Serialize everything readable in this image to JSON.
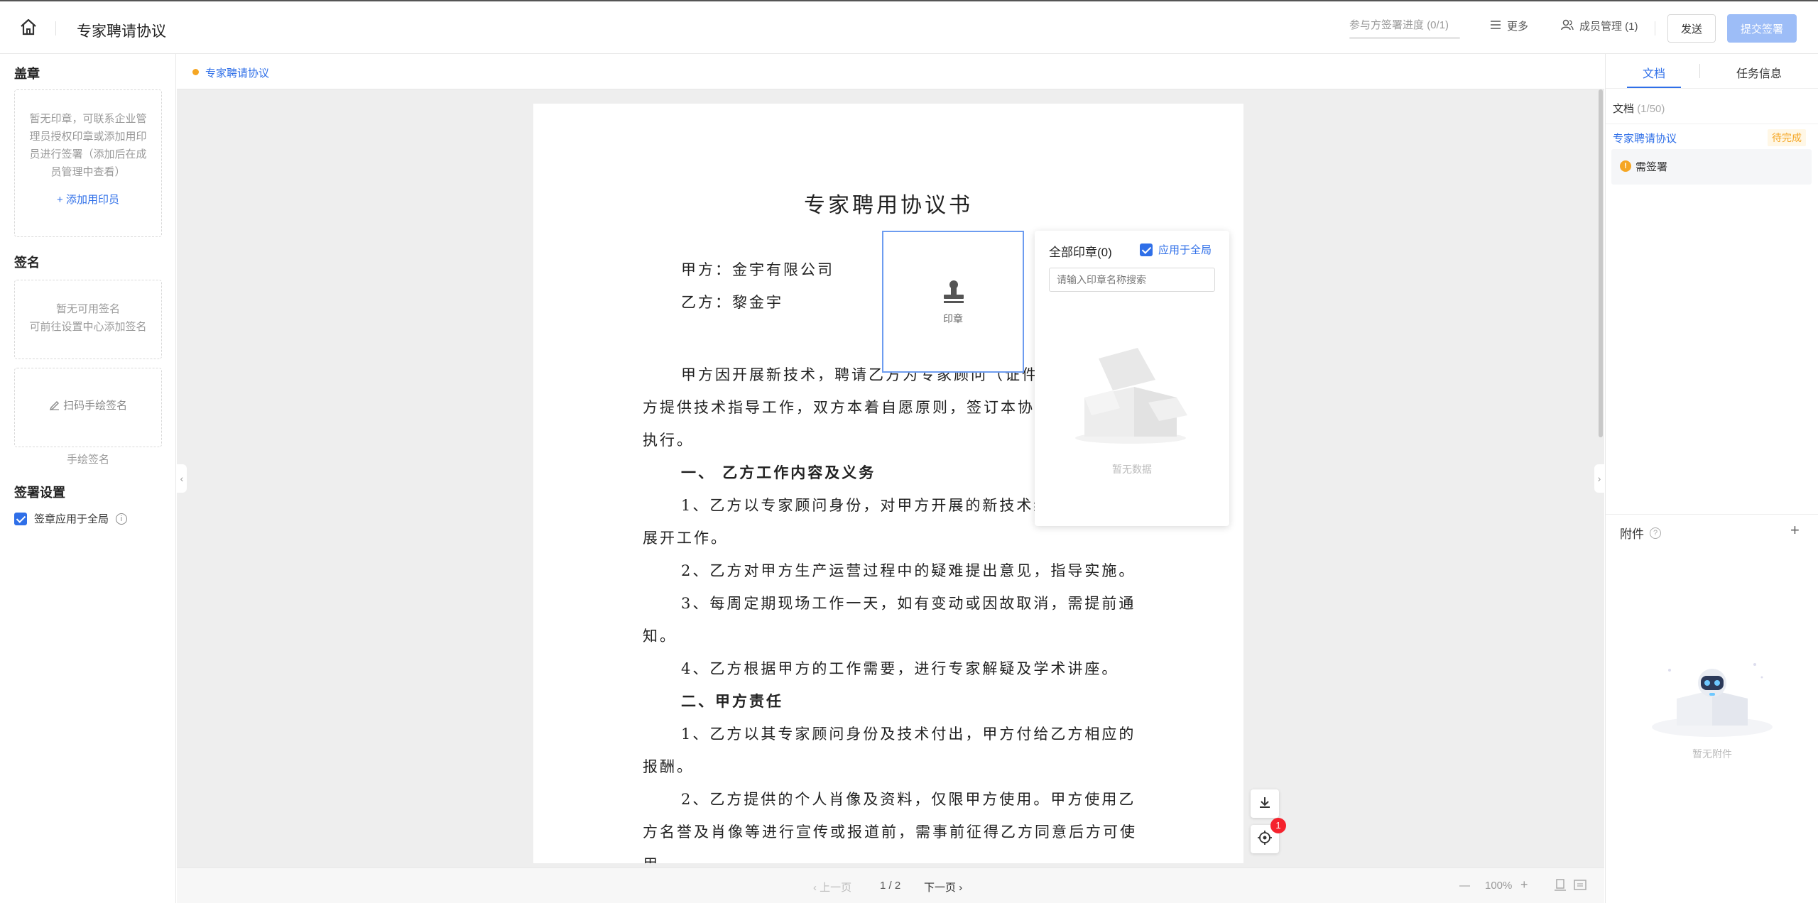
{
  "header": {
    "title": "专家聘请协议",
    "progress_label": "参与方签署进度",
    "progress_count": "(0/1)",
    "progress_fraction": 0,
    "more_label": "更多",
    "members_label": "成员管理 (1)",
    "send_label": "发送",
    "submit_label": "提交签署"
  },
  "left_panel": {
    "seal_title": "盖章",
    "seal_empty_text": "暂无印章，可联系企业管理员授权印章或添加用印员进行签署（添加后在成员管理中查看）",
    "add_sealer_label": "+ 添加用印员",
    "signature_title": "签名",
    "signature_empty_line1": "暂无可用签名",
    "signature_empty_line2": "可前往设置中心添加签名",
    "scan_sign_label": "扫码手绘签名",
    "handwritten_caption": "手绘签名",
    "settings_title": "签署设置",
    "apply_all_label": "签章应用于全局",
    "apply_all_checked": true
  },
  "document": {
    "tab_label": "专家聘请协议",
    "title": "专家聘用协议书",
    "party_a": "甲方：金宇有限公司",
    "party_b": "乙方：黎金宇",
    "lines": [
      "甲方因开展新技术，聘请乙方为专家顾问（证件号",
      "方提供技术指导工作，双方本着自愿原则，签订本协议",
      "执行。",
      "一、  乙方工作内容及义务",
      "1、乙方以专家顾问身份，对甲方开展的新技术给",
      "展开工作。",
      "2、乙方对甲方生产运营过程中的疑难提出意见，指导实施。",
      "3、每周定期现场工作一天，如有变动或因故取消，需提前通",
      "知。",
      "4、乙方根据甲方的工作需要，进行专家解疑及学术讲座。",
      "二、甲方责任",
      "1、乙方以其专家顾问身份及技术付出，甲方付给乙方相应的",
      "报酬。",
      "2、乙方提供的个人肖像及资料，仅限甲方使用。甲方使用乙",
      "方名誉及肖像等进行宣传或报道前，需事前征得乙方同意后方可使",
      "用。"
    ],
    "stamp_label": "印章"
  },
  "seal_popup": {
    "title": "全部印章(0)",
    "apply_label": "应用于全局",
    "apply_checked": true,
    "search_placeholder": "请输入印章名称搜索",
    "empty_text": "暂无数据"
  },
  "floating": {
    "download_icon": "download-icon",
    "locate_icon": "locate-icon",
    "badge_count": "1"
  },
  "bottom_bar": {
    "prev_label": "上一页",
    "page_indicator": "1 / 2",
    "next_label": "下一页",
    "zoom_out": "—",
    "zoom_level": "100%",
    "zoom_in": "+"
  },
  "right_panel": {
    "tab_doc": "文档",
    "tab_task": "任务信息",
    "doc_count_label": "文档",
    "doc_count": "(1/50)",
    "doc_name": "专家聘请协议",
    "doc_status": "待完成",
    "sign_item": "需签署",
    "attachments_title": "附件",
    "attachments_empty": "暂无附件"
  },
  "colors": {
    "accent": "#2f6fe8",
    "submit_disabled": "#9dbdf7",
    "warning": "#f5a623",
    "badge": "#f5222d"
  }
}
